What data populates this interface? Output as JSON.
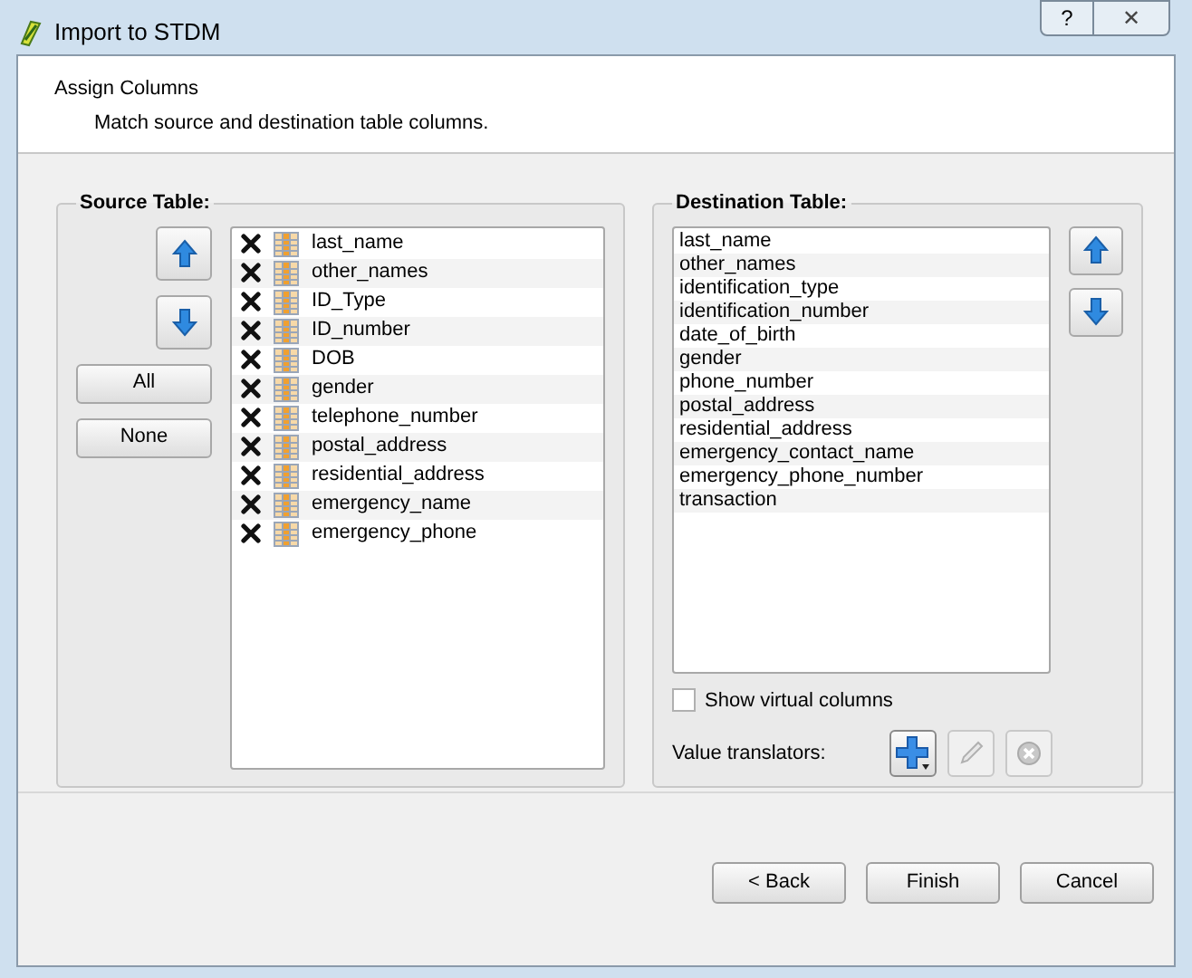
{
  "window": {
    "title": "Import to STDM",
    "help_button": "?",
    "close_button": "✕"
  },
  "header": {
    "title": "Assign Columns",
    "subtitle": "Match source and destination table columns."
  },
  "source_table": {
    "title": "Source Table:",
    "select_buttons": [
      "All",
      "None"
    ],
    "columns": [
      {
        "name": "last_name",
        "checked": true
      },
      {
        "name": "other_names",
        "checked": true
      },
      {
        "name": "ID_Type",
        "checked": true
      },
      {
        "name": "ID_number",
        "checked": true
      },
      {
        "name": "DOB",
        "checked": true
      },
      {
        "name": "gender",
        "checked": true
      },
      {
        "name": "telephone_number",
        "checked": true
      },
      {
        "name": "postal_address",
        "checked": true
      },
      {
        "name": "residential_address",
        "checked": true
      },
      {
        "name": "emergency_name",
        "checked": true
      },
      {
        "name": "emergency_phone",
        "checked": true
      }
    ]
  },
  "destination_table": {
    "title": "Destination Table:",
    "columns": [
      "last_name",
      "other_names",
      "identification_type",
      "identification_number",
      "date_of_birth",
      "gender",
      "phone_number",
      "postal_address",
      "residential_address",
      "emergency_contact_name",
      "emergency_phone_number",
      "transaction"
    ],
    "show_virtual_columns": {
      "label": "Show virtual columns",
      "checked": false
    },
    "value_translators": {
      "label": "Value translators:",
      "buttons": [
        {
          "kind": "add",
          "disabled": false
        },
        {
          "kind": "edit",
          "disabled": true
        },
        {
          "kind": "delete",
          "disabled": true
        }
      ]
    }
  },
  "buttons": [
    "< Back",
    "Finish",
    "Cancel"
  ]
}
